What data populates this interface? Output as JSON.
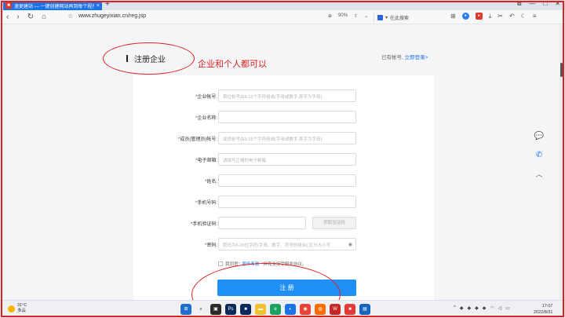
{
  "browser": {
    "tab_title": "速更建站 — 一键创建网站再到每个程序",
    "tab_close": "×",
    "new_tab": "+",
    "window_controls": [
      "⧉",
      "—",
      "□",
      "✕"
    ],
    "url": "www.zhugeyixian.cn/reg.jsp",
    "zoom_level": "90%",
    "search_placeholder": "在此搜索",
    "nav_back": "‹",
    "nav_forward": "›",
    "nav_reload": "↻",
    "nav_home": "⌂"
  },
  "page": {
    "heading": "注册企业",
    "annotation": "企业和个人都可以",
    "login_prompt": "已有帐号,",
    "login_link": "立即登录>",
    "form": {
      "company_account": {
        "label": "企业帐号:",
        "placeholder": "首位帐号由6-15个字符组成(字母或数字,首字为字母)"
      },
      "company_name": {
        "label": "企业名称:",
        "placeholder": ""
      },
      "admin_account": {
        "label": "成员(管理员)帐号:",
        "placeholder": "成员帐号由3-15个字符组成(字母或数字,首字为字母)"
      },
      "email": {
        "label": "电子邮箱:",
        "placeholder": "请填写正确的电子邮箱"
      },
      "name": {
        "label": "姓名:",
        "placeholder": ""
      },
      "phone": {
        "label": "手机号码:",
        "placeholder": ""
      },
      "sms_code": {
        "label": "手机验证码:",
        "placeholder": "",
        "button": "获取验证码"
      },
      "password": {
        "label": "密码:",
        "placeholder": "密码为6-20位字符(字母、数字、符号的组合),区分大小写"
      }
    },
    "agreement_prefix": "我同意\"",
    "agreement_link": "服务条款",
    "agreement_suffix": "\"并完全接受服务协议。",
    "submit_label": "注 册"
  },
  "taskbar": {
    "temperature": "31°C",
    "weather": "多云",
    "time": "17:07",
    "date": "2022/8/31"
  },
  "colors": {
    "accent": "#1e8ff5",
    "annotation_red": "#e02020"
  }
}
